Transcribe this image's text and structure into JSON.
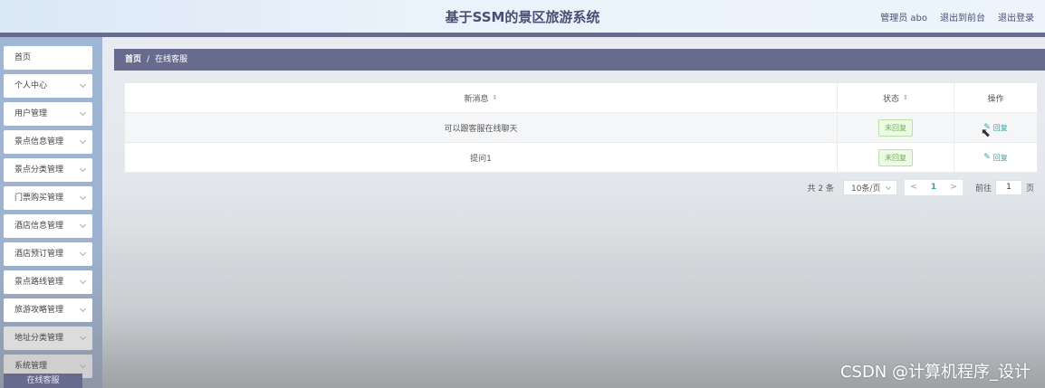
{
  "header": {
    "title": "基于SSM的景区旅游系统",
    "admin": "管理员 abo",
    "to_front": "退出到前台",
    "logout": "退出登录"
  },
  "sidebar": {
    "items": [
      {
        "label": "首页",
        "has_chevron": false
      },
      {
        "label": "个人中心",
        "has_chevron": true
      },
      {
        "label": "用户管理",
        "has_chevron": true
      },
      {
        "label": "景点信息管理",
        "has_chevron": true
      },
      {
        "label": "景点分类管理",
        "has_chevron": true
      },
      {
        "label": "门票购买管理",
        "has_chevron": true
      },
      {
        "label": "酒店信息管理",
        "has_chevron": true
      },
      {
        "label": "酒店预订管理",
        "has_chevron": true
      },
      {
        "label": "景点路线管理",
        "has_chevron": true
      },
      {
        "label": "旅游攻略管理",
        "has_chevron": true
      },
      {
        "label": "地址分类管理",
        "has_chevron": true
      },
      {
        "label": "系统管理",
        "has_chevron": true
      }
    ],
    "active_sub": "在线客服"
  },
  "breadcrumb": {
    "home": "首页",
    "separator": "/",
    "current": "在线客服"
  },
  "table": {
    "columns": [
      "新消息",
      "状态",
      "操作"
    ],
    "rows": [
      {
        "message": "可以跟客服在线聊天",
        "status": "未回复",
        "action": "回复"
      },
      {
        "message": "提问1",
        "status": "未回复",
        "action": "回复"
      }
    ]
  },
  "pagination": {
    "total": "共 2 条",
    "page_size": "10条/页",
    "prev": "<",
    "current": "1",
    "next": ">",
    "goto": "前往",
    "page_input": "1",
    "page_unit": "页"
  },
  "watermark": "CSDN @计算机程序_设计",
  "colors": {
    "primary": "#676c8e",
    "accent": "#3aa1a1",
    "status_green": "#6bb34c"
  }
}
